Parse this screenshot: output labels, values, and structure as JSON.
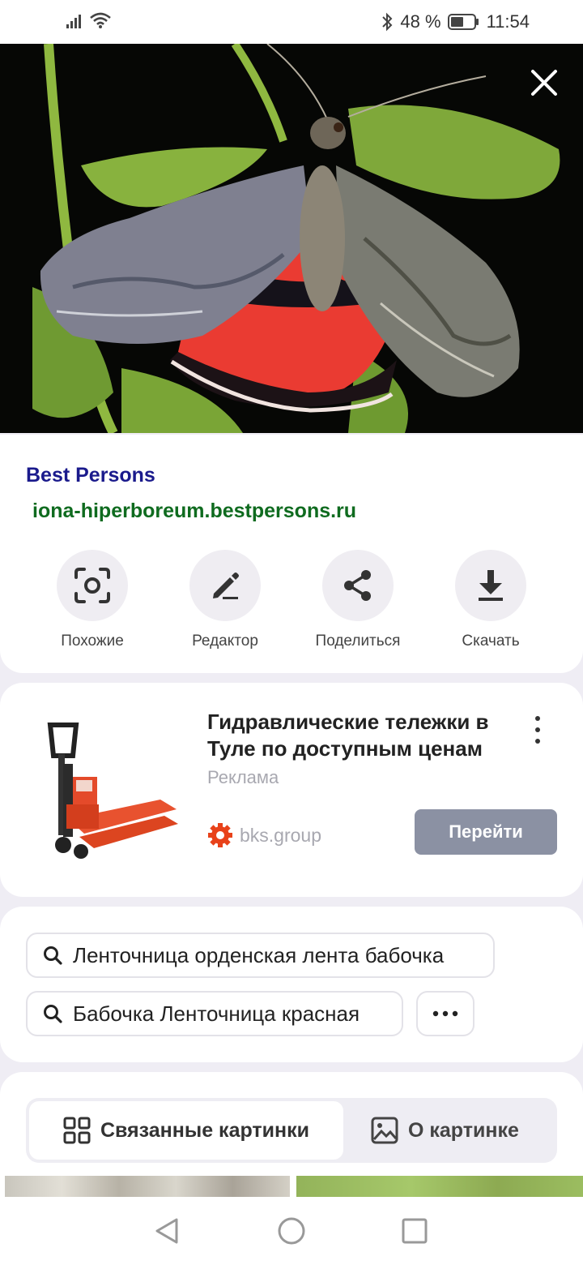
{
  "status_bar": {
    "battery_percent": "48 %",
    "time": "11:54"
  },
  "source": {
    "name": "Best Persons",
    "url": "iona-hiperboreum.bestpersons.ru"
  },
  "actions": [
    {
      "label": "Похожие",
      "icon": "lens-scan-icon"
    },
    {
      "label": "Редактор",
      "icon": "pencil-icon"
    },
    {
      "label": "Поделиться",
      "icon": "share-icon"
    },
    {
      "label": "Скачать",
      "icon": "download-icon"
    }
  ],
  "ad": {
    "title": "Гидравлические тележки в Туле по доступным ценам",
    "label": "Реклама",
    "domain": "bks.group",
    "button_label": "Перейти"
  },
  "related_searches": [
    "Ленточница орденская лента бабочка",
    "Бабочка Ленточница красная"
  ],
  "tabs": {
    "related_images": "Связанные картинки",
    "about_image": "О картинке"
  },
  "colors": {
    "source_name": "#1a1a8c",
    "source_url": "#0f6b1f",
    "ad_button": "#8b91a3",
    "ad_gear": "#e8421a"
  }
}
